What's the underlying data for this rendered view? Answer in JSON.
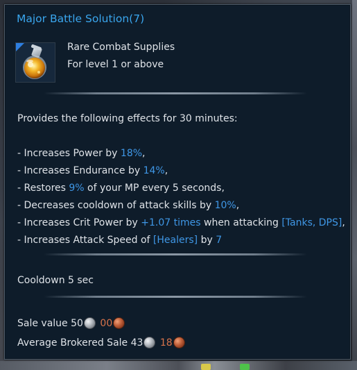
{
  "tooltip": {
    "title": "Major Battle Solution(7)",
    "icon": "potion-flask-icon",
    "category": "Rare Combat Supplies",
    "level_req": "For level 1 or above",
    "effects_intro": "Provides the following effects for 30 minutes:",
    "effects": [
      {
        "parts": [
          {
            "t": "- Increases Power by "
          },
          {
            "t": "18%",
            "hl": true
          },
          {
            "t": ","
          }
        ]
      },
      {
        "parts": [
          {
            "t": "- Increases Endurance by "
          },
          {
            "t": "14%",
            "hl": true
          },
          {
            "t": ","
          }
        ]
      },
      {
        "parts": [
          {
            "t": "- Restores "
          },
          {
            "t": "9%",
            "hl": true
          },
          {
            "t": " of your MP every 5 seconds,"
          }
        ]
      },
      {
        "parts": [
          {
            "t": "- Decreases cooldown of attack skills by "
          },
          {
            "t": "10%",
            "hl": true
          },
          {
            "t": ","
          }
        ]
      },
      {
        "parts": [
          {
            "t": "- Increases Crit Power by "
          },
          {
            "t": "+1.07 times",
            "hl": true
          },
          {
            "t": " when attacking "
          },
          {
            "t": "[Tanks, DPS]",
            "hl": true
          },
          {
            "t": ","
          }
        ]
      },
      {
        "parts": [
          {
            "t": "- Increases Attack Speed of "
          },
          {
            "t": "[Healers]",
            "hl": true
          },
          {
            "t": " by "
          },
          {
            "t": "7",
            "hl": true
          }
        ]
      }
    ],
    "cooldown": "Cooldown  5 sec",
    "sale_value": {
      "label": "Sale value",
      "silver": "50",
      "copper": "00"
    },
    "brokered_sale": {
      "label": "Average Brokered Sale",
      "silver": "43",
      "copper": "18"
    },
    "colors": {
      "title": "#3aa6ee",
      "highlight": "#3f97e6",
      "body_text": "#dfe3e8",
      "copper_text": "#d9734a",
      "panel_bg": "#0e1c2a"
    }
  }
}
